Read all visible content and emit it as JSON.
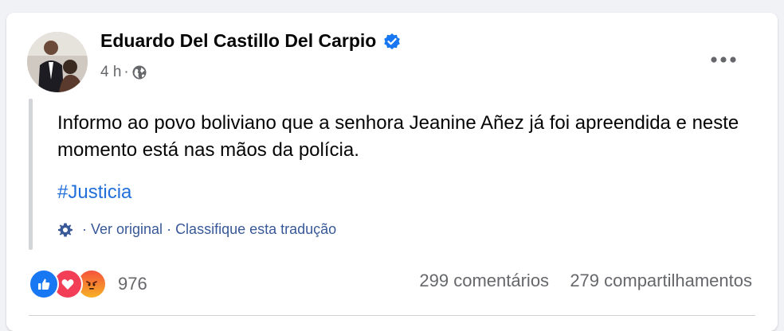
{
  "post": {
    "author": "Eduardo Del Castillo Del Carpio",
    "time": "4 h",
    "separator": "·",
    "text": "Informo ao povo boliviano que a senhora Jeanine Añez já foi apreendida e neste momento está nas mãos da polícia.",
    "hashtag": "#Justicia"
  },
  "translation": {
    "separator": "·",
    "see_original": "Ver original",
    "rate": "Classifique esta tradução"
  },
  "engagement": {
    "reaction_count": "976",
    "comments": "299 comentários",
    "shares": "279 compartilhamentos"
  },
  "colors": {
    "link": "#216fdb",
    "verified": "#1877f2",
    "muted": "#65676b"
  },
  "icons": {
    "verified": "verified-badge-icon",
    "globe": "globe-icon",
    "more": "more-options-icon",
    "gear": "gear-icon",
    "like": "like-reaction-icon",
    "love": "love-reaction-icon",
    "angry": "angry-reaction-icon"
  }
}
